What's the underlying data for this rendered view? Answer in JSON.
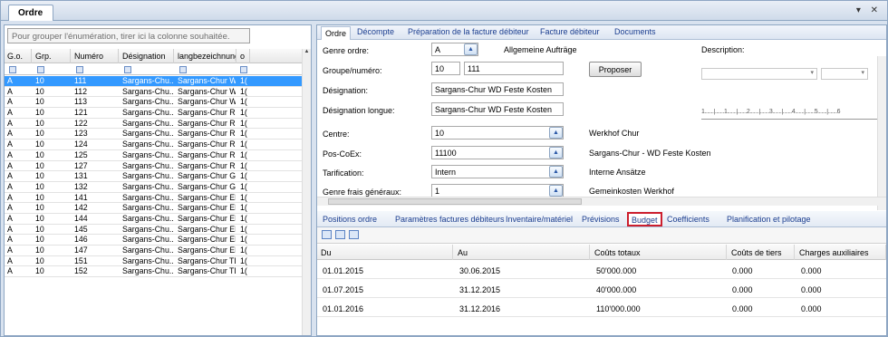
{
  "window": {
    "tab_label": "Ordre",
    "controls": "▾ ✕"
  },
  "left": {
    "group_hint": "Pour grouper l'énumération, tirer ici la colonne souhaitée.",
    "columns": [
      "G.o.",
      "Grp.",
      "Numéro",
      "Désignation",
      "langbezeichnung",
      "o"
    ],
    "rows": [
      [
        "A",
        "10",
        "111",
        "Sargans-Chu...",
        "Sargans-Chur WD...",
        "1("
      ],
      [
        "A",
        "10",
        "112",
        "Sargans-Chu...",
        "Sargans-Chur WD...",
        "1("
      ],
      [
        "A",
        "10",
        "113",
        "Sargans-Chu...",
        "Sargans-Chur WD...",
        "1("
      ],
      [
        "A",
        "10",
        "121",
        "Sargans-Chu...",
        "Sargans-Chur RE...",
        "1("
      ],
      [
        "A",
        "10",
        "122",
        "Sargans-Chu...",
        "Sargans-Chur RE...",
        "1("
      ],
      [
        "A",
        "10",
        "123",
        "Sargans-Chu...",
        "Sargans-Chur RE...",
        "1("
      ],
      [
        "A",
        "10",
        "124",
        "Sargans-Chu...",
        "Sargans-Chur RE...",
        "1("
      ],
      [
        "A",
        "10",
        "125",
        "Sargans-Chu...",
        "Sargans-Chur RE...",
        "1("
      ],
      [
        "A",
        "10",
        "127",
        "Sargans-Chu...",
        "Sargans-Chur RE...",
        "1("
      ],
      [
        "A",
        "10",
        "131",
        "Sargans-Chu...",
        "Sargans-Chur GR...",
        "1("
      ],
      [
        "A",
        "10",
        "132",
        "Sargans-Chu...",
        "Sargans-Chur GR...",
        "1("
      ],
      [
        "A",
        "10",
        "141",
        "Sargans-Chu...",
        "Sargans-Chur EM...",
        "1("
      ],
      [
        "A",
        "10",
        "142",
        "Sargans-Chu...",
        "Sargans-Chur EM...",
        "1("
      ],
      [
        "A",
        "10",
        "144",
        "Sargans-Chu...",
        "Sargans-Chur EM...",
        "1("
      ],
      [
        "A",
        "10",
        "145",
        "Sargans-Chu...",
        "Sargans-Chur EM...",
        "1("
      ],
      [
        "A",
        "10",
        "146",
        "Sargans-Chu...",
        "Sargans-Chur EM...",
        "1("
      ],
      [
        "A",
        "10",
        "147",
        "Sargans-Chu...",
        "Sargans-Chur EM...",
        "1("
      ],
      [
        "A",
        "10",
        "151",
        "Sargans-Chu...",
        "Sargans-Chur TD...",
        "1("
      ],
      [
        "A",
        "10",
        "152",
        "Sargans-Chu...",
        "Sargans-Chur TD...",
        "1("
      ]
    ]
  },
  "top_tabs": [
    "Ordre",
    "Décompte",
    "Préparation de la facture débiteur",
    "Facture débiteur",
    "Documents"
  ],
  "form": {
    "genre_ordre": {
      "label": "Genre ordre:",
      "value": "A",
      "desc": "Allgemeine Aufträge"
    },
    "groupe": {
      "label": "Groupe/numéro:",
      "group": "10",
      "number": "111",
      "button": "Proposer"
    },
    "designation": {
      "label": "Désignation:",
      "value": "Sargans-Chur WD Feste Kosten"
    },
    "designation_longue": {
      "label": "Désignation longue:",
      "value": "Sargans-Chur WD Feste Kosten"
    },
    "centre": {
      "label": "Centre:",
      "value": "10",
      "desc": "Werkhof Chur"
    },
    "pos_coex": {
      "label": "Pos-CoEx:",
      "value": "11100",
      "desc": "Sargans-Chur - WD Feste Kosten"
    },
    "tarification": {
      "label": "Tarification:",
      "value": "Intern",
      "desc": "Interne Ansätze"
    },
    "genre_frais": {
      "label": "Genre frais généraux:",
      "value": "1",
      "desc": "Gemeinkosten Werkhof"
    },
    "description_label": "Description:",
    "ruler": "1.......|.......1.......|.......2.......|.......3.......|.......4.......|.......5.......|.......6"
  },
  "bottom_tabs": [
    "Positions ordre",
    "Paramètres factures débiteurs",
    "Inventaire/matériel",
    "Prévisions",
    "Budget",
    "Coefficients",
    "Planification et pilotage"
  ],
  "budget": {
    "columns": [
      "Du",
      "Au",
      "Coûts totaux",
      "Coûts de tiers",
      "Charges auxiliaires"
    ],
    "rows": [
      [
        "01.01.2015",
        "30.06.2015",
        "50'000.000",
        "0.000",
        "0.000"
      ],
      [
        "01.07.2015",
        "31.12.2015",
        "40'000.000",
        "0.000",
        "0.000"
      ],
      [
        "01.01.2016",
        "31.12.2016",
        "110'000.000",
        "0.000",
        "0.000"
      ]
    ]
  },
  "colors": {
    "selection": "#3399ff",
    "highlight_border": "#cc1f2e",
    "link": "#1a3d8f"
  }
}
